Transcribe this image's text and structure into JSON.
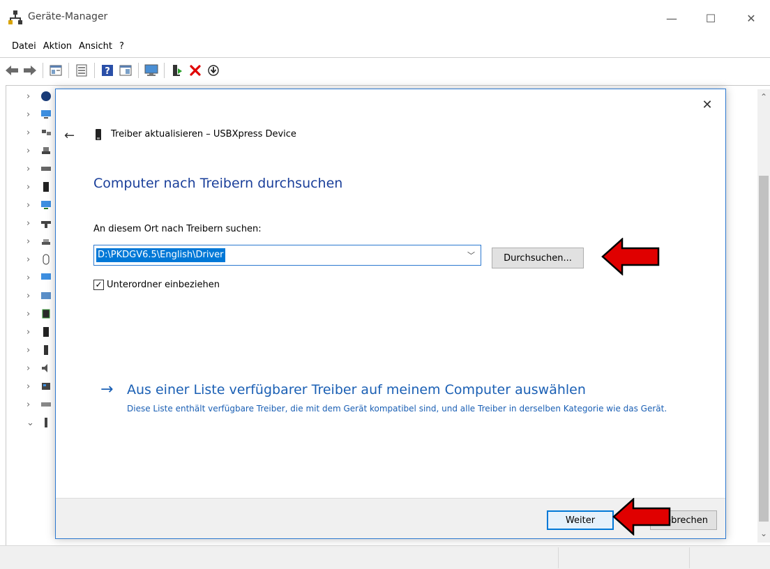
{
  "window": {
    "title": "Geräte-Manager",
    "minimize": "—",
    "maximize": "☐",
    "close": "✕"
  },
  "menu": {
    "items": [
      "Datei",
      "Aktion",
      "Ansicht",
      "?"
    ]
  },
  "dialog": {
    "close": "✕",
    "back": "←",
    "title": "Treiber aktualisieren – USBXpress Device",
    "heading": "Computer nach Treibern durchsuchen",
    "search_label": "An diesem Ort nach Treibern suchen:",
    "path_value": "D:\\PKDGV6.5\\English\\Driver",
    "browse_label": "Durchsuchen...",
    "subfolders_label": "Unterordner einbeziehen",
    "subfolders_checked": true,
    "option_arrow": "→",
    "option_title": "Aus einer Liste verfügbarer Treiber auf meinem Computer auswählen",
    "option_desc": "Diese Liste enthält verfügbare Treiber, die mit dem Gerät kompatibel sind, und alle Treiber in derselben Kategorie wie das Gerät.",
    "next_label": "Weiter",
    "cancel_label": "Abbrechen"
  },
  "colors": {
    "accent": "#0078d7",
    "link": "#1a5fb4",
    "heading": "#1a3f9a",
    "annotation": "#e00000"
  }
}
